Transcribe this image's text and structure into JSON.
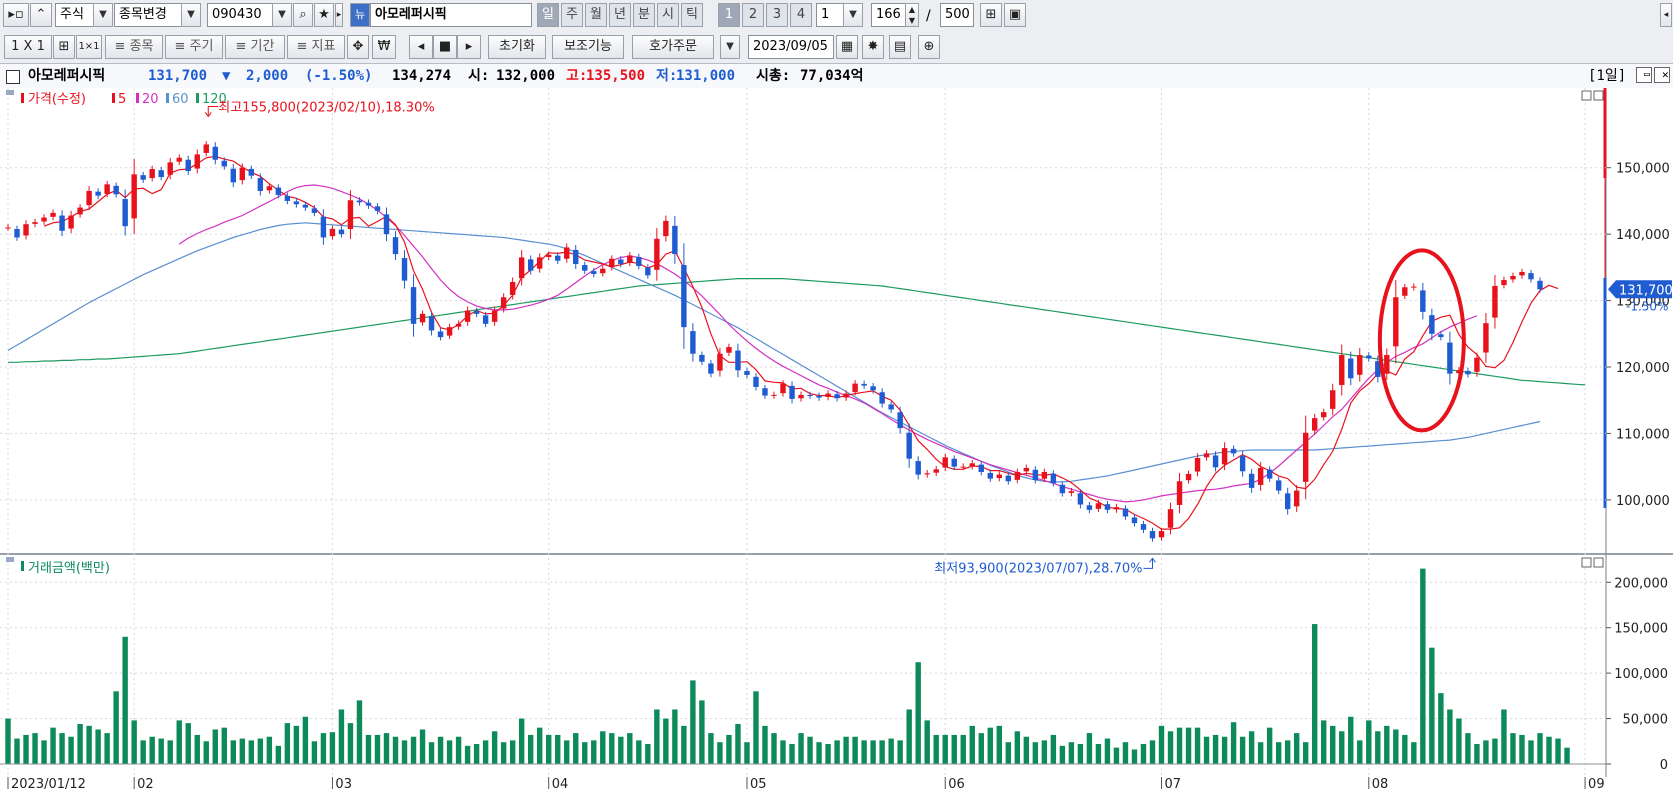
{
  "toolbar1": {
    "market": "주식",
    "change_stock": "종목변경",
    "code": "090430",
    "stock_name": "아모레퍼시픽",
    "periods": [
      "일",
      "주",
      "월",
      "년",
      "분",
      "시",
      "틱"
    ],
    "selected_period": "일",
    "multipliers": [
      "1",
      "2",
      "3",
      "4"
    ],
    "selected_multiplier": "1",
    "interval": "1",
    "count": "166",
    "slash": "/",
    "max_count": "500"
  },
  "toolbar2": {
    "layout": "1 X 1",
    "menus": [
      "종목",
      "주기",
      "기간",
      "지표"
    ],
    "reset": "초기화",
    "aux": "보조기능",
    "order": "호가주문",
    "date": "2023/09/05"
  },
  "info_bar": {
    "name": "아모레퍼시픽",
    "price": "131,700",
    "change_arrow": "▼",
    "change": "2,000",
    "change_pct": "(-1.50%)",
    "volume": "134,274",
    "open_label": "시:",
    "open": "132,000",
    "high_label": "고:",
    "high": "135,500",
    "low_label": "저:",
    "low": "131,000",
    "cap_label": "시총:",
    "cap": "77,034억",
    "period_tag": "[1일]"
  },
  "colors": {
    "up": "#e8121d",
    "down": "#1f5bd1",
    "ma5": "#e8121d",
    "ma20": "#d430c2",
    "ma60": "#5a8fd0",
    "ma120": "#1f9b62",
    "volume_bar": "#0d8a5a",
    "annotation_circle": "#e8121d",
    "price_label_bg": "#1f5bd1"
  },
  "chart_data": [
    {
      "type": "candlestick",
      "title": "가격(수정)",
      "legend": [
        "5",
        "20",
        "60",
        "120"
      ],
      "ylim": [
        92000,
        162000
      ],
      "y_ticks": [
        100000,
        110000,
        120000,
        130000,
        140000,
        150000
      ],
      "y_tick_labels": [
        "100,000",
        "110,000",
        "120,000",
        "130,000",
        "140,000",
        "150,000"
      ],
      "x_ticks": [
        {
          "label": "2023/01/12",
          "i": 0
        },
        {
          "label": "02",
          "i": 14
        },
        {
          "label": "03",
          "i": 36
        },
        {
          "label": "04",
          "i": 60
        },
        {
          "label": "05",
          "i": 82
        },
        {
          "label": "06",
          "i": 104
        },
        {
          "label": "07",
          "i": 128
        },
        {
          "label": "08",
          "i": 151
        },
        {
          "label": "09",
          "i": 175
        }
      ],
      "max_annotation": "최고155,800(2023/02/10),18.30%",
      "min_annotation": "최저93,900(2023/07/07),28.70%",
      "current_price_label": "131,700",
      "current_change_label": "-1.50%",
      "close": [
        141000,
        139500,
        141500,
        141800,
        142500,
        143200,
        140500,
        142800,
        144000,
        146500,
        145800,
        147500,
        146000,
        141200,
        149000,
        148200,
        149800,
        148600,
        150800,
        151500,
        149500,
        152000,
        153500,
        151200,
        150200,
        147800,
        150000,
        148800,
        146500,
        147200,
        145900,
        145000,
        144500,
        144000,
        143200,
        139500,
        140800,
        140000,
        145100,
        144800,
        144300,
        143500,
        140000,
        137000,
        133000,
        126500,
        128000,
        125500,
        124500,
        126000,
        126500,
        128500,
        128000,
        126500,
        128500,
        130500,
        132800,
        136500,
        134500,
        136500,
        136900,
        136000,
        138000,
        135500,
        134500,
        134000,
        134800,
        136300,
        135500,
        136800,
        135200,
        133800,
        139300,
        142000,
        137000,
        126000,
        122000,
        120800,
        119000,
        122000,
        123000,
        119500,
        118800,
        117000,
        115700,
        115800,
        117500,
        115200,
        115800,
        115700,
        115400,
        116000,
        115300,
        116000,
        117500,
        117200,
        116500,
        114500,
        113600,
        110800,
        106200,
        103800,
        104000,
        104600,
        106400,
        105000,
        105000,
        105500,
        104200,
        103200,
        103800,
        102800,
        104200,
        104800,
        103000,
        104200,
        102500,
        101000,
        101300,
        99300,
        98500,
        99500,
        98500,
        98900,
        97500,
        96500,
        95500,
        94200,
        95300,
        98600,
        102800,
        103900,
        106300,
        107000,
        104900,
        107800,
        107000,
        104300,
        101800,
        104800,
        103200,
        101400,
        98600,
        101400,
        110100,
        112300,
        113200,
        116500,
        121800,
        118300,
        121800,
        121300,
        118500,
        121800,
        130500,
        132000,
        132100,
        128300,
        125000,
        124500,
        119000,
        119500,
        118900,
        121400,
        126600,
        132200,
        133100,
        133700,
        134300,
        133200,
        131700
      ],
      "ma5": [
        null,
        null,
        null,
        null,
        141200,
        141700,
        141900,
        142600,
        143400,
        143800,
        144900,
        146000,
        146600,
        145500,
        146800,
        146900,
        146100,
        146700,
        149200,
        149700,
        149800,
        150600,
        151500,
        151700,
        151300,
        151000,
        150100,
        149300,
        148700,
        147600,
        146600,
        145700,
        145400,
        144800,
        144000,
        142600,
        142300,
        141400,
        142400,
        142500,
        141200,
        141900,
        142700,
        141400,
        138800,
        134500,
        131700,
        128200,
        125900,
        125600,
        126400,
        127700,
        128500,
        128000,
        128100,
        129300,
        130800,
        133500,
        134600,
        135900,
        137200,
        137100,
        137300,
        136900,
        136100,
        135800,
        135500,
        135100,
        135400,
        135800,
        135600,
        134900,
        135400,
        137000,
        137500,
        134900,
        132100,
        129000,
        125000,
        121700,
        120700,
        120700,
        120800,
        119600,
        117900,
        117700,
        117600,
        116700,
        116800,
        116000,
        115700,
        115700,
        115400,
        115700,
        116000,
        116200,
        116400,
        115600,
        115000,
        113500,
        111200,
        108900,
        107600,
        106100,
        105000,
        104600,
        104600,
        105100,
        105000,
        104400,
        104400,
        104000,
        103700,
        104000,
        103800,
        103700,
        103900,
        103300,
        102600,
        101500,
        100300,
        99700,
        98900,
        98700,
        98600,
        97800,
        97200,
        96500,
        95600,
        95600,
        95800,
        97200,
        99300,
        102000,
        104000,
        105200,
        106000,
        106800,
        106100,
        105000,
        104400,
        103600,
        103200,
        101900,
        101700,
        103100,
        105300,
        107300,
        110600,
        114600,
        116400,
        117500,
        119000,
        119400,
        118800,
        121200,
        122300,
        124700,
        126900,
        127500,
        127800,
        124900,
        123000,
        121900,
        120100,
        119900,
        121000,
        123700,
        126800,
        129600,
        131500,
        132300,
        131800
      ],
      "ma20": [
        null,
        null,
        null,
        null,
        null,
        null,
        null,
        null,
        null,
        null,
        null,
        null,
        null,
        null,
        null,
        null,
        null,
        null,
        null,
        138500,
        139400,
        140100,
        140700,
        141200,
        141800,
        142300,
        142800,
        143500,
        144200,
        144900,
        145600,
        146400,
        147000,
        147300,
        147400,
        147200,
        146900,
        146400,
        145900,
        145300,
        144500,
        143600,
        142500,
        141300,
        139800,
        138200,
        136600,
        134800,
        133100,
        131700,
        130600,
        129800,
        129200,
        128800,
        128600,
        128600,
        128700,
        129000,
        129300,
        129700,
        130200,
        130800,
        131700,
        132700,
        133700,
        134600,
        135400,
        136000,
        136500,
        136700,
        136500,
        136100,
        135600,
        134800,
        134000,
        133000,
        131900,
        130700,
        129300,
        127900,
        126400,
        125100,
        123900,
        122800,
        121800,
        120900,
        120100,
        119400,
        118700,
        118000,
        117300,
        116800,
        116200,
        115700,
        115200,
        114600,
        113800,
        113000,
        112100,
        111300,
        110500,
        109800,
        109100,
        108500,
        107900,
        107300,
        106800,
        106300,
        105800,
        105300,
        104900,
        104500,
        104100,
        103700,
        103300,
        102900,
        102500,
        102000,
        101600,
        101200,
        100800,
        100400,
        100100,
        99900,
        99700,
        99800,
        100000,
        100300,
        100600,
        100800,
        101000,
        101200,
        101400,
        101500,
        101600,
        101800,
        102100,
        102300,
        102500,
        103100,
        104000,
        105100,
        106300,
        107500,
        108700,
        109900,
        111200,
        112500,
        113600,
        115200,
        116800,
        118300,
        119600,
        120700,
        121600,
        122200,
        122900,
        123500,
        124400,
        125300,
        126000,
        126600,
        127200,
        127700
      ],
      "ma60": [
        122500,
        123300,
        124100,
        124900,
        125700,
        126500,
        127300,
        128100,
        128900,
        129700,
        130400,
        131100,
        131800,
        132500,
        133200,
        133900,
        134500,
        135100,
        135700,
        136300,
        136900,
        137500,
        138000,
        138500,
        139000,
        139500,
        139900,
        140300,
        140700,
        141000,
        141300,
        141500,
        141600,
        141700,
        141600,
        141500,
        141400,
        141300,
        141200,
        141100,
        141000,
        140900,
        140800,
        140700,
        140600,
        140500,
        140400,
        140300,
        140200,
        140100,
        140000,
        139900,
        139800,
        139700,
        139600,
        139500,
        139300,
        139100,
        138900,
        138700,
        138500,
        138200,
        137800,
        137300,
        136800,
        136200,
        135600,
        135000,
        134400,
        133800,
        133200,
        132600,
        132000,
        131400,
        130800,
        130100,
        129400,
        128700,
        128000,
        127300,
        126600,
        125900,
        125100,
        124300,
        123500,
        122700,
        121900,
        121100,
        120300,
        119500,
        118700,
        117900,
        117100,
        116300,
        115500,
        114700,
        113900,
        113100,
        112400,
        111700,
        111000,
        110300,
        109600,
        108900,
        108200,
        107600,
        107000,
        106400,
        105800,
        105200,
        104700,
        104200,
        103700,
        103300,
        103000,
        102800,
        102700,
        102700,
        102800,
        103000,
        103200,
        103400,
        103600,
        103900,
        104200,
        104500,
        104800,
        105100,
        105400,
        105700,
        106000,
        106300,
        106600,
        106800,
        107000,
        107200,
        107300,
        107400,
        107500,
        107500,
        107500,
        107500,
        107500,
        107500,
        107500,
        107500,
        107600,
        107700,
        107800,
        107900,
        108000,
        108100,
        108200,
        108300,
        108400,
        108500,
        108600,
        108700,
        108800,
        108900,
        109000,
        109200,
        109400,
        109700,
        110000,
        110300,
        110600,
        110900,
        111200,
        111500,
        111800
      ],
      "ma120": [
        120700,
        120700,
        120800,
        120800,
        120900,
        120900,
        121000,
        121000,
        121100,
        121100,
        121200,
        121200,
        121300,
        121400,
        121500,
        121600,
        121700,
        121800,
        121900,
        122000,
        122200,
        122400,
        122600,
        122800,
        123000,
        123200,
        123400,
        123600,
        123800,
        124000,
        124200,
        124400,
        124600,
        124800,
        125000,
        125200,
        125400,
        125600,
        125800,
        126000,
        126200,
        126400,
        126600,
        126800,
        127000,
        127200,
        127400,
        127600,
        127800,
        128000,
        128200,
        128400,
        128600,
        128800,
        129000,
        129200,
        129400,
        129600,
        129800,
        130000,
        130200,
        130400,
        130600,
        130800,
        131000,
        131200,
        131400,
        131600,
        131800,
        132000,
        132200,
        132300,
        132400,
        132500,
        132600,
        132700,
        132800,
        132900,
        133000,
        133100,
        133200,
        133300,
        133300,
        133300,
        133300,
        133300,
        133300,
        133200,
        133100,
        133000,
        132900,
        132800,
        132700,
        132600,
        132500,
        132400,
        132300,
        132200,
        132000,
        131800,
        131600,
        131400,
        131200,
        131000,
        130800,
        130600,
        130400,
        130200,
        130000,
        129800,
        129600,
        129400,
        129200,
        129000,
        128800,
        128600,
        128400,
        128200,
        128000,
        127800,
        127600,
        127400,
        127200,
        127000,
        126800,
        126600,
        126400,
        126200,
        126000,
        125800,
        125600,
        125400,
        125200,
        125000,
        124800,
        124600,
        124400,
        124200,
        124000,
        123800,
        123600,
        123400,
        123200,
        123000,
        122800,
        122600,
        122400,
        122200,
        122000,
        121800,
        121600,
        121400,
        121200,
        121000,
        120800,
        120600,
        120400,
        120200,
        120000,
        119800,
        119600,
        119400,
        119200,
        119000,
        118800,
        118600,
        118400,
        118200,
        118000,
        117900,
        117800,
        117700,
        117600,
        117500,
        117400,
        117300
      ]
    },
    {
      "type": "bar",
      "title": "거래금액(백만)",
      "ylim": [
        0,
        230000
      ],
      "y_ticks": [
        0,
        50000,
        100000,
        150000,
        200000
      ],
      "y_tick_labels": [
        "0",
        "50,000",
        "100,000",
        "150,000",
        "200,000"
      ],
      "values": [
        50000,
        28000,
        32000,
        34000,
        26000,
        40000,
        34000,
        30000,
        44000,
        42000,
        38000,
        34000,
        80000,
        140000,
        48000,
        26000,
        30000,
        28000,
        26000,
        48000,
        45000,
        32000,
        25000,
        38000,
        40000,
        26000,
        28000,
        26000,
        28000,
        30000,
        20000,
        45000,
        42000,
        52000,
        25000,
        34000,
        35000,
        60000,
        45000,
        70000,
        32000,
        32000,
        34000,
        30000,
        26000,
        30000,
        38000,
        24000,
        30000,
        26000,
        30000,
        20000,
        22000,
        26000,
        36000,
        24000,
        26000,
        50000,
        32000,
        40000,
        32000,
        32000,
        26000,
        34000,
        24000,
        26000,
        36000,
        34000,
        30000,
        34000,
        26000,
        22000,
        60000,
        50000,
        60000,
        42000,
        92000,
        70000,
        34000,
        24000,
        32000,
        44000,
        24000,
        80000,
        42000,
        34000,
        26000,
        22000,
        34000,
        30000,
        24000,
        22000,
        26000,
        30000,
        30000,
        26000,
        26000,
        26000,
        28000,
        26000,
        60000,
        112000,
        48000,
        32000,
        32000,
        32000,
        32000,
        42000,
        34000,
        40000,
        42000,
        24000,
        36000,
        30000,
        24000,
        26000,
        32000,
        20000,
        24000,
        22000,
        34000,
        22000,
        28000,
        18000,
        24000,
        16000,
        22000,
        26000,
        42000,
        36000,
        40000,
        40000,
        40000,
        30000,
        32000,
        30000,
        46000,
        30000,
        36000,
        24000,
        40000,
        24000,
        26000,
        34000,
        24000,
        154000,
        48000,
        42000,
        36000,
        52000,
        26000,
        48000,
        36000,
        42000,
        38000,
        32000,
        24000,
        215000,
        128000,
        78000,
        60000,
        50000,
        34000,
        22000,
        26000,
        28000,
        60000,
        34000,
        32000,
        26000,
        34000,
        30000,
        28000,
        18000
      ]
    }
  ]
}
